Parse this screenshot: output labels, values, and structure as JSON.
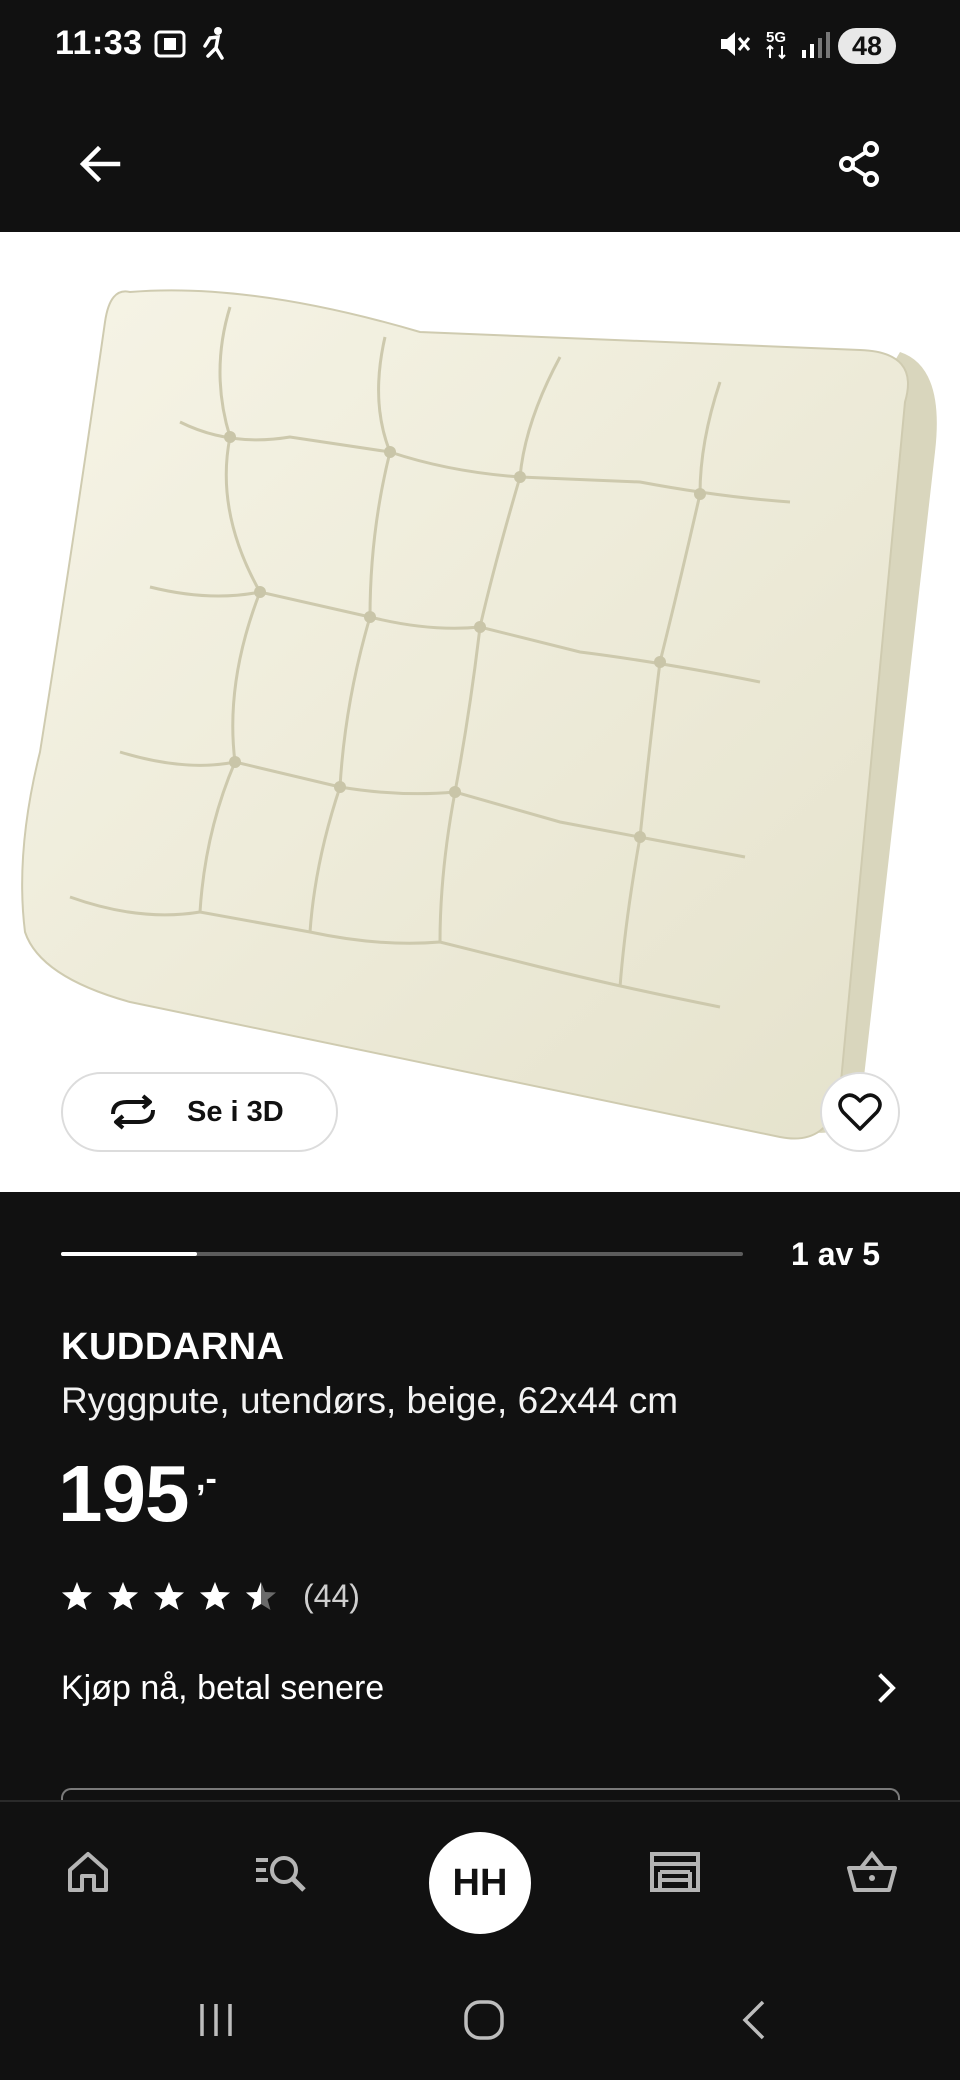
{
  "status_bar": {
    "time": "11:33",
    "battery": "48",
    "network": "5G",
    "icons": [
      "screenshot-icon",
      "running-person-icon",
      "mute-icon",
      "5g-icon",
      "signal-icon",
      "battery-icon"
    ]
  },
  "top_nav": {
    "icons": [
      "back-arrow-icon",
      "share-icon"
    ]
  },
  "gallery": {
    "view_3d_label": "Se i 3D",
    "page_indicator": "1 av 5",
    "progress_fraction": 0.2
  },
  "product": {
    "name": "KUDDARNA",
    "description": "Ryggpute, utendørs, beige, 62x44 cm",
    "price": "195",
    "price_suffix": ",-",
    "rating": 4.5,
    "rating_count": "(44)",
    "pay_later_label": "Kjøp nå, betal senere"
  },
  "bottom_tabs": {
    "avatar_initials": "HH",
    "icons": [
      "home-icon",
      "search-list-icon",
      "store-icon",
      "basket-icon"
    ]
  },
  "colors": {
    "background": "#111111",
    "image_background": "#ffffff",
    "cushion": "#f1efdf",
    "progress_track": "#5c5c5c"
  }
}
